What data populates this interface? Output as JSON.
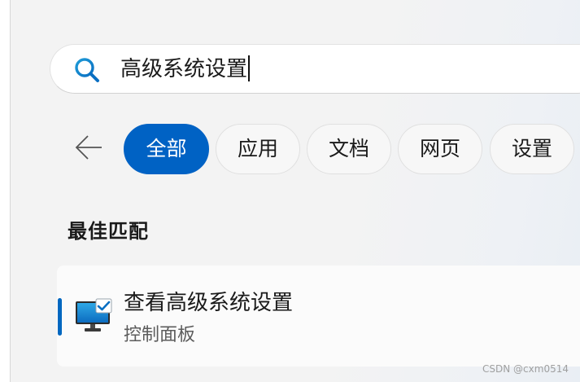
{
  "search": {
    "query": "高级系统设置"
  },
  "filters": {
    "back_icon": "back-arrow-icon",
    "chips": [
      {
        "label": "全部",
        "active": true
      },
      {
        "label": "应用",
        "active": false
      },
      {
        "label": "文档",
        "active": false
      },
      {
        "label": "网页",
        "active": false
      },
      {
        "label": "设置",
        "active": false
      }
    ]
  },
  "best_match": {
    "heading": "最佳匹配",
    "result": {
      "title": "查看高级系统设置",
      "subtitle": "控制面板",
      "icon": "monitor-checkmark-icon"
    }
  },
  "watermark": "CSDN @cxm0514",
  "colors": {
    "accent": "#0062c4",
    "panel_bg": "#f3f3f3"
  }
}
